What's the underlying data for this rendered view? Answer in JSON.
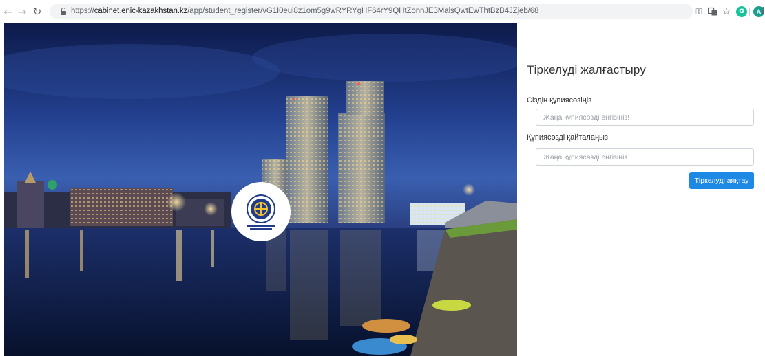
{
  "browser": {
    "url_prefix": "https://",
    "url_host": "cabinet.enic-kazakhstan.kz",
    "url_path": "/app/student_register/vG1I0eui8z1om5g9wRYRYgHF64rY9QHtZonnJE3MalsQwtEwThtBzB4JZjeb/68",
    "profile_initial": "A",
    "extension_initial": "G",
    "icons": [
      "back-arrow-icon",
      "forward-arrow-icon",
      "reload-icon",
      "lock-icon",
      "key-icon",
      "translate-icon",
      "star-icon",
      "grammarly-icon",
      "profile-avatar",
      "menu-dots-icon"
    ]
  },
  "hero": {
    "description_icons": [
      "city-night-photo",
      "enic-logo"
    ]
  },
  "form": {
    "title": "Тіркелуді жалғастыру",
    "password_label": "Сіздің құпиясөзіңіз",
    "password_placeholder": "Жаңа құпиясөзді енгізіңіз!",
    "repeat_label": "Құпиясөзді қайталаңыз",
    "repeat_placeholder": "Жаңа құпиясөзді енгізіңіз",
    "submit_label": "Тіркелуді аяқтау",
    "accent_color": "#1e88e5"
  }
}
